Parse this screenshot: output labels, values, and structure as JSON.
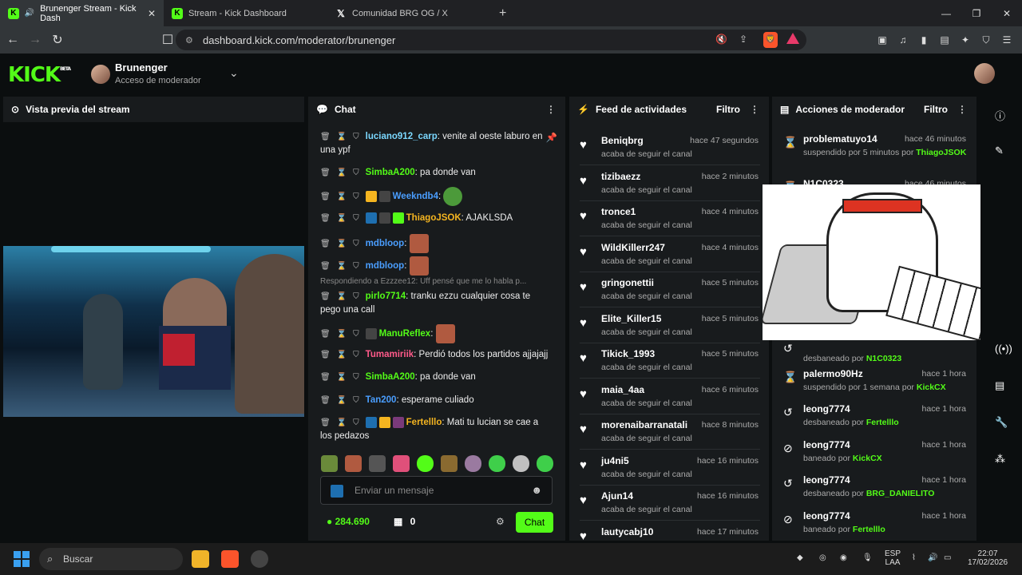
{
  "browser": {
    "tabs": [
      {
        "label": "Brunenger Stream - Kick Dash",
        "icon": "kick-icon"
      },
      {
        "label": "Stream - Kick Dashboard",
        "icon": "kick-icon"
      },
      {
        "label": "Comunidad BRG OG / X",
        "icon": "x-icon"
      }
    ],
    "url": "dashboard.kick.com/moderator/brunenger"
  },
  "header": {
    "logo": "KICK",
    "beta": "BETA",
    "channel_name": "Brunenger",
    "channel_role": "Acceso de moderador"
  },
  "preview": {
    "title": "Vista previa del stream"
  },
  "chat": {
    "title": "Chat",
    "messages": [
      {
        "user": "luciano912_carp",
        "color": "#7bd8ff",
        "text": ": venite al oeste laburo en una ypf",
        "line2": "una ypf"
      },
      {
        "user": "SimbaA200",
        "color": "#53fc18",
        "text": ": pa donde van"
      },
      {
        "user": "Weekndb4",
        "color": "#4a9eff",
        "text": ":"
      },
      {
        "user": "ThiagoJSOK",
        "color": "#f5b520",
        "text": ": AJAKLSDA"
      },
      {
        "user": "mdbloop",
        "color": "#4a9eff",
        "text": ":"
      },
      {
        "user": "mdbloop",
        "color": "#4a9eff",
        "text": ":"
      },
      {
        "user": "pirlo7714",
        "color": "#53fc18",
        "text": ": tranku ezzu cualquier cosa te pego una call",
        "line2": "pego una call"
      },
      {
        "user": "ManuReflex",
        "color": "#53fc18",
        "text": ":"
      },
      {
        "user": "Tumamiriik",
        "color": "#ff5a8a",
        "text": ": Perdió todos los partidos ajjajajj"
      },
      {
        "user": "SimbaA200",
        "color": "#53fc18",
        "text": ": pa donde van"
      },
      {
        "user": "Tan200",
        "color": "#4a9eff",
        "text": ": esperame culiado"
      },
      {
        "user": "Fertelllo",
        "color": "#f5b520",
        "text": ": Mati tu lucian se cae a los pedazos",
        "line2": "los pedazos"
      }
    ],
    "reply": "Respondiendo a Ezzzee12: Uff pensé que me lo habla p...",
    "input_placeholder": "Enviar un mensaje",
    "points": "284.690",
    "store_count": "0",
    "send_label": "Chat"
  },
  "feed": {
    "title": "Feed de actividades",
    "filter": "Filtro",
    "items": [
      {
        "name": "Beniqbrg",
        "time": "hace 47 segundos",
        "action": "acaba de seguir el canal"
      },
      {
        "name": "tizibaezz",
        "time": "hace 2 minutos",
        "action": "acaba de seguir el canal"
      },
      {
        "name": "tronce1",
        "time": "hace 4 minutos",
        "action": "acaba de seguir el canal"
      },
      {
        "name": "WildKillerr247",
        "time": "hace 4 minutos",
        "action": "acaba de seguir el canal"
      },
      {
        "name": "gringonettii",
        "time": "hace 5 minutos",
        "action": "acaba de seguir el canal"
      },
      {
        "name": "Elite_Killer15",
        "time": "hace 5 minutos",
        "action": "acaba de seguir el canal"
      },
      {
        "name": "Tikick_1993",
        "time": "hace 5 minutos",
        "action": "acaba de seguir el canal"
      },
      {
        "name": "maia_4aa",
        "time": "hace 6 minutos",
        "action": "acaba de seguir el canal"
      },
      {
        "name": "morenaibarranatali",
        "time": "hace 8 minutos",
        "action": "acaba de seguir el canal"
      },
      {
        "name": "ju4ni5",
        "time": "hace 16 minutos",
        "action": "acaba de seguir el canal"
      },
      {
        "name": "Ajun14",
        "time": "hace 16 minutos",
        "action": "acaba de seguir el canal"
      },
      {
        "name": "lautycabj10",
        "time": "hace 17 minutos",
        "action": ""
      }
    ]
  },
  "mod": {
    "title": "Acciones de moderador",
    "filter": "Filtro",
    "items": [
      {
        "name": "problematuyo14",
        "time": "hace 46 minutos",
        "action": "suspendido por 5 minutos por",
        "by": "ThiagoJSOK",
        "icon": "hourglass-icon"
      },
      {
        "name": "N1C0323",
        "time": "hace 46 minutos",
        "action": "",
        "by": "",
        "icon": "hourglass-icon"
      },
      {
        "name": "",
        "time": "",
        "action": "desbaneado por",
        "by": "N1C0323",
        "icon": "unban-icon"
      },
      {
        "name": "palermo90Hz",
        "time": "hace 1 hora",
        "action": "suspendido por 1 semana por",
        "by": "KickCX",
        "icon": "hourglass-icon"
      },
      {
        "name": "leong7774",
        "time": "hace 1 hora",
        "action": "desbaneado por",
        "by": "Fertelllo",
        "icon": "unban-icon"
      },
      {
        "name": "leong7774",
        "time": "hace 1 hora",
        "action": "baneado por",
        "by": "KickCX",
        "icon": "ban-icon"
      },
      {
        "name": "leong7774",
        "time": "hace 1 hora",
        "action": "desbaneado por",
        "by": "BRG_DANIELITO",
        "icon": "unban-icon"
      },
      {
        "name": "leong7774",
        "time": "hace 1 hora",
        "action": "baneado por",
        "by": "Fertelllo",
        "icon": "ban-icon"
      }
    ]
  },
  "taskbar": {
    "search": "Buscar",
    "lang": "ESP",
    "lang2": "LAA",
    "time": "22:07",
    "date": "17/02/2026"
  }
}
